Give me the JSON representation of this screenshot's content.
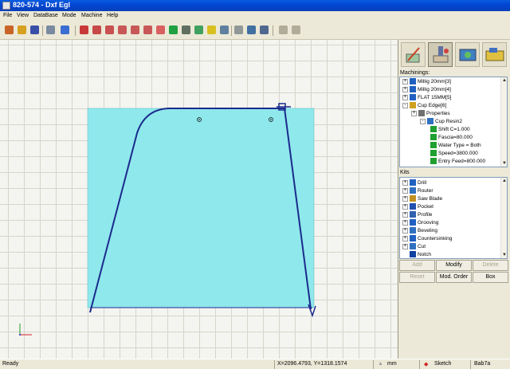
{
  "window": {
    "title": "820-574 - Dxf Egl"
  },
  "menu": [
    "File",
    "View",
    "DataBase",
    "Mode",
    "Machine",
    "Help"
  ],
  "panel": {
    "machinings_label": "Machinings:",
    "machinings": [
      {
        "label": "Millig 20mm[3]",
        "expander": "+"
      },
      {
        "label": "Millig 20mm[4]",
        "expander": "+"
      },
      {
        "label": "FLAT 15MM[5]",
        "expander": "+"
      },
      {
        "label": "Cup Edge[6]",
        "expander": "-"
      },
      {
        "label": "Properties",
        "expander": "+"
      },
      {
        "label": "Cup Resin2",
        "expander": "-"
      },
      {
        "label": "Shift C=1.000"
      },
      {
        "label": "Fascia=80.000"
      },
      {
        "label": "Water Type = Both"
      },
      {
        "label": "Speed=3800.000"
      },
      {
        "label": "Entry Feed=800.000"
      }
    ],
    "kits_label": "Kits",
    "kits": [
      "Drill",
      "Router",
      "Saw Blade",
      "Pocket",
      "Profile",
      "Grooving",
      "Beveling",
      "Countersinking",
      "Cut",
      "Notch"
    ],
    "buttons": {
      "add": "Add",
      "modify": "Modify",
      "delete": "Delete",
      "reset": "Reset",
      "mod_order": "Mod. Order",
      "box": "Box"
    }
  },
  "status": {
    "ready": "Ready",
    "coords": "X=2096.4793, Y=1318.1574",
    "unit": "mm",
    "mode": "Sketch",
    "code": "Bab7a"
  },
  "colors": {
    "workpiece": "#8fe8ec",
    "path": "#1b2a8c",
    "titlebar": "#0a5ddf"
  }
}
